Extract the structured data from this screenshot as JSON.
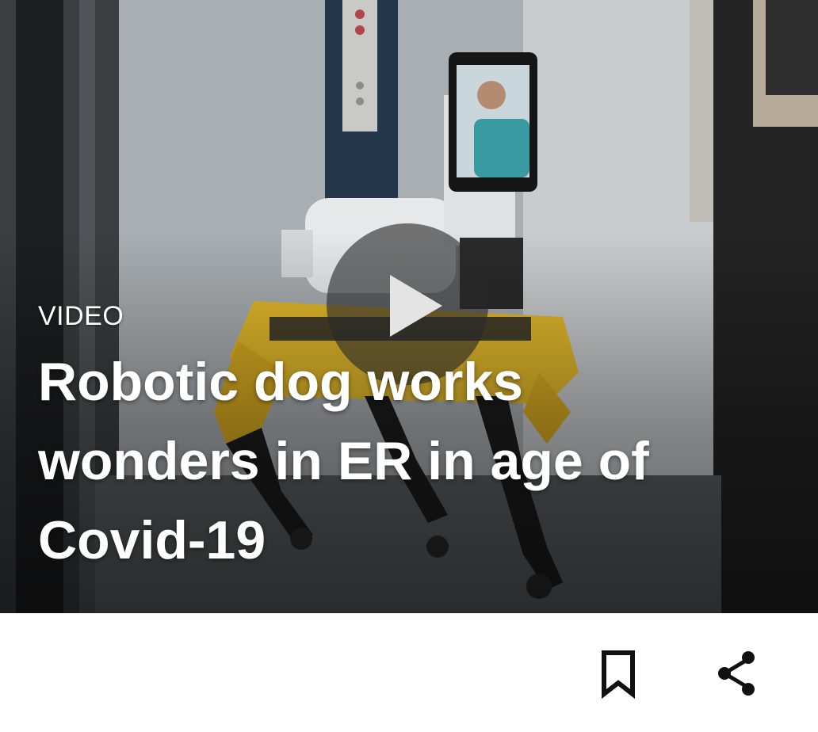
{
  "card": {
    "kicker": "VIDEO",
    "headline": "Robotic dog works wonders in ER in age of Covid-19"
  },
  "media": {
    "thumbnail_subject": "yellow four-legged robot with a tablet showing a masked doctor, in a hospital hallway",
    "play_icon": "play-icon"
  },
  "actions": {
    "bookmark_icon": "bookmark-icon",
    "share_icon": "share-icon"
  },
  "colors": {
    "text_on_media": "#ffffff",
    "icon": "#111111",
    "play_overlay": "rgba(40,40,40,0.62)",
    "robot_yellow": "#e3b92b"
  }
}
